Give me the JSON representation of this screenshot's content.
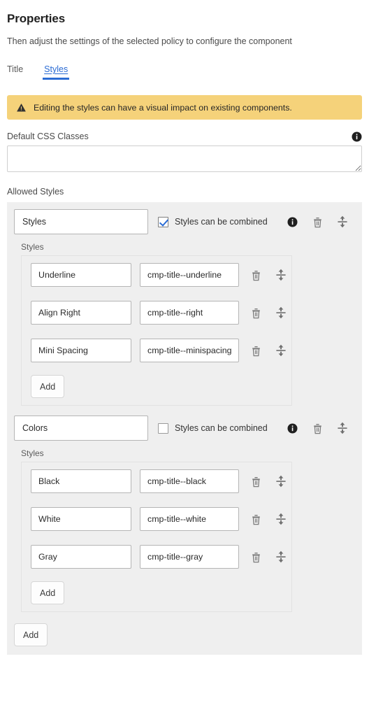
{
  "header": {
    "title": "Properties",
    "description": "Then adjust the settings of the selected policy to configure the component"
  },
  "tabs": [
    {
      "label": "Title",
      "active": false,
      "name": "tab-title"
    },
    {
      "label": "Styles",
      "active": true,
      "name": "tab-styles"
    }
  ],
  "alert": {
    "icon": "warning-triangle-icon",
    "text": "Editing the styles can have a visual impact on existing components.",
    "background": "#f5d27a"
  },
  "default_css": {
    "label": "Default CSS Classes",
    "value": "",
    "placeholder": "",
    "info_icon": "info-icon"
  },
  "allowed_styles": {
    "label": "Allowed Styles",
    "sub_label": "Styles",
    "combine_label": "Styles can be combined",
    "add_label": "Add",
    "icons": {
      "info": "info-icon",
      "delete": "trash-icon",
      "reorder": "drag-reorder-icon"
    },
    "groups": [
      {
        "name": "Styles",
        "combinable": true,
        "styles": [
          {
            "name": "Underline",
            "css_class": "cmp-title--underline"
          },
          {
            "name": "Align Right",
            "css_class": "cmp-title--right"
          },
          {
            "name": "Mini Spacing",
            "css_class": "cmp-title--minispacing"
          }
        ]
      },
      {
        "name": "Colors",
        "combinable": false,
        "styles": [
          {
            "name": "Black",
            "css_class": "cmp-title--black"
          },
          {
            "name": "White",
            "css_class": "cmp-title--white"
          },
          {
            "name": "Gray",
            "css_class": "cmp-title--gray"
          }
        ]
      }
    ],
    "outer_add_label": "Add"
  },
  "colors": {
    "accent": "#2b6cd4",
    "panel_bg": "#efefef",
    "alert_bg": "#f5d27a",
    "text": "#2b2b2b"
  }
}
